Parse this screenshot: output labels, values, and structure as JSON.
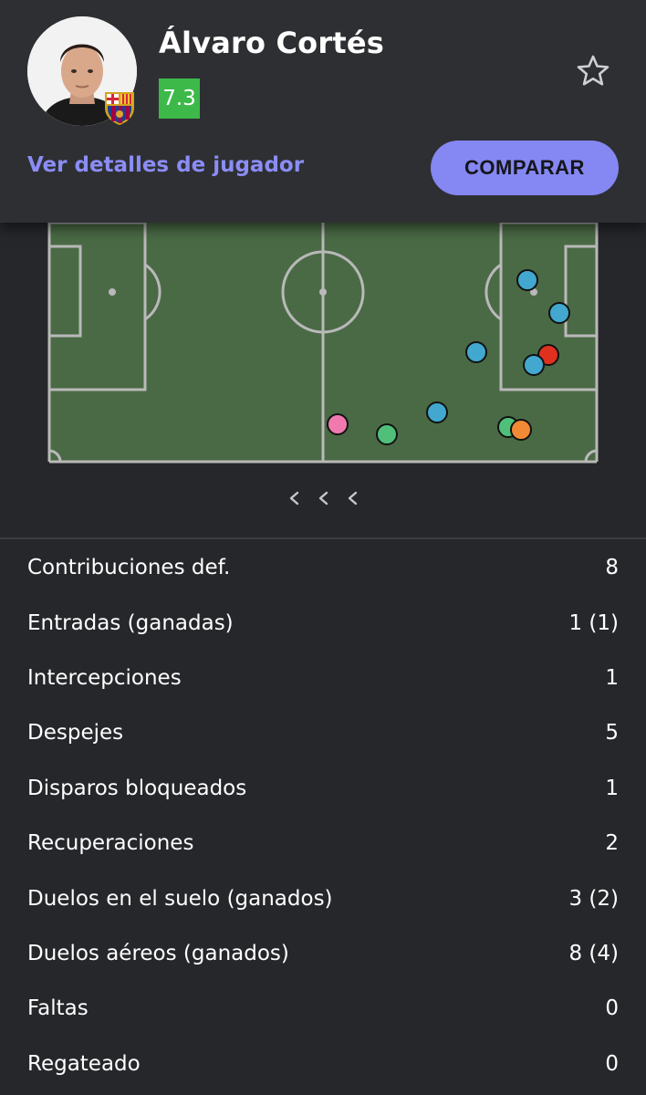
{
  "player": {
    "name": "Álvaro Cortés",
    "rating": "7.3",
    "details_link": "Ver detalles de jugador",
    "compare_button": "COMPARAR",
    "favorite_icon": "star-outline-icon",
    "club_badge_icon": "fc-barcelona-crest-icon"
  },
  "colors": {
    "rating_bg": "#3db94a",
    "accent": "#8587f2",
    "pitch": "#4a6a45",
    "background": "#26272b"
  },
  "pitch_actions": [
    {
      "type": "blue",
      "color": "#42a8cf"
    },
    {
      "type": "blue",
      "color": "#42a8cf"
    },
    {
      "type": "blue",
      "color": "#42a8cf"
    },
    {
      "type": "red",
      "color": "#e0301e"
    },
    {
      "type": "blue",
      "color": "#42a8cf"
    },
    {
      "type": "blue",
      "color": "#42a8cf"
    },
    {
      "type": "pink",
      "color": "#f07ab0"
    },
    {
      "type": "green",
      "color": "#4fbf7a"
    },
    {
      "type": "green",
      "color": "#4fbf7a"
    },
    {
      "type": "orange",
      "color": "#f08a35"
    }
  ],
  "stats": [
    {
      "label": "Contribuciones def.",
      "value": "8"
    },
    {
      "label": "Entradas (ganadas)",
      "value": "1 (1)"
    },
    {
      "label": "Intercepciones",
      "value": "1"
    },
    {
      "label": "Despejes",
      "value": "5"
    },
    {
      "label": "Disparos bloqueados",
      "value": "1"
    },
    {
      "label": "Recuperaciones",
      "value": "2"
    },
    {
      "label": "Duelos en el suelo (ganados)",
      "value": "3 (2)"
    },
    {
      "label": "Duelos aéreos (ganados)",
      "value": "8 (4)"
    },
    {
      "label": "Faltas",
      "value": "0"
    },
    {
      "label": "Regateado",
      "value": "0"
    }
  ]
}
